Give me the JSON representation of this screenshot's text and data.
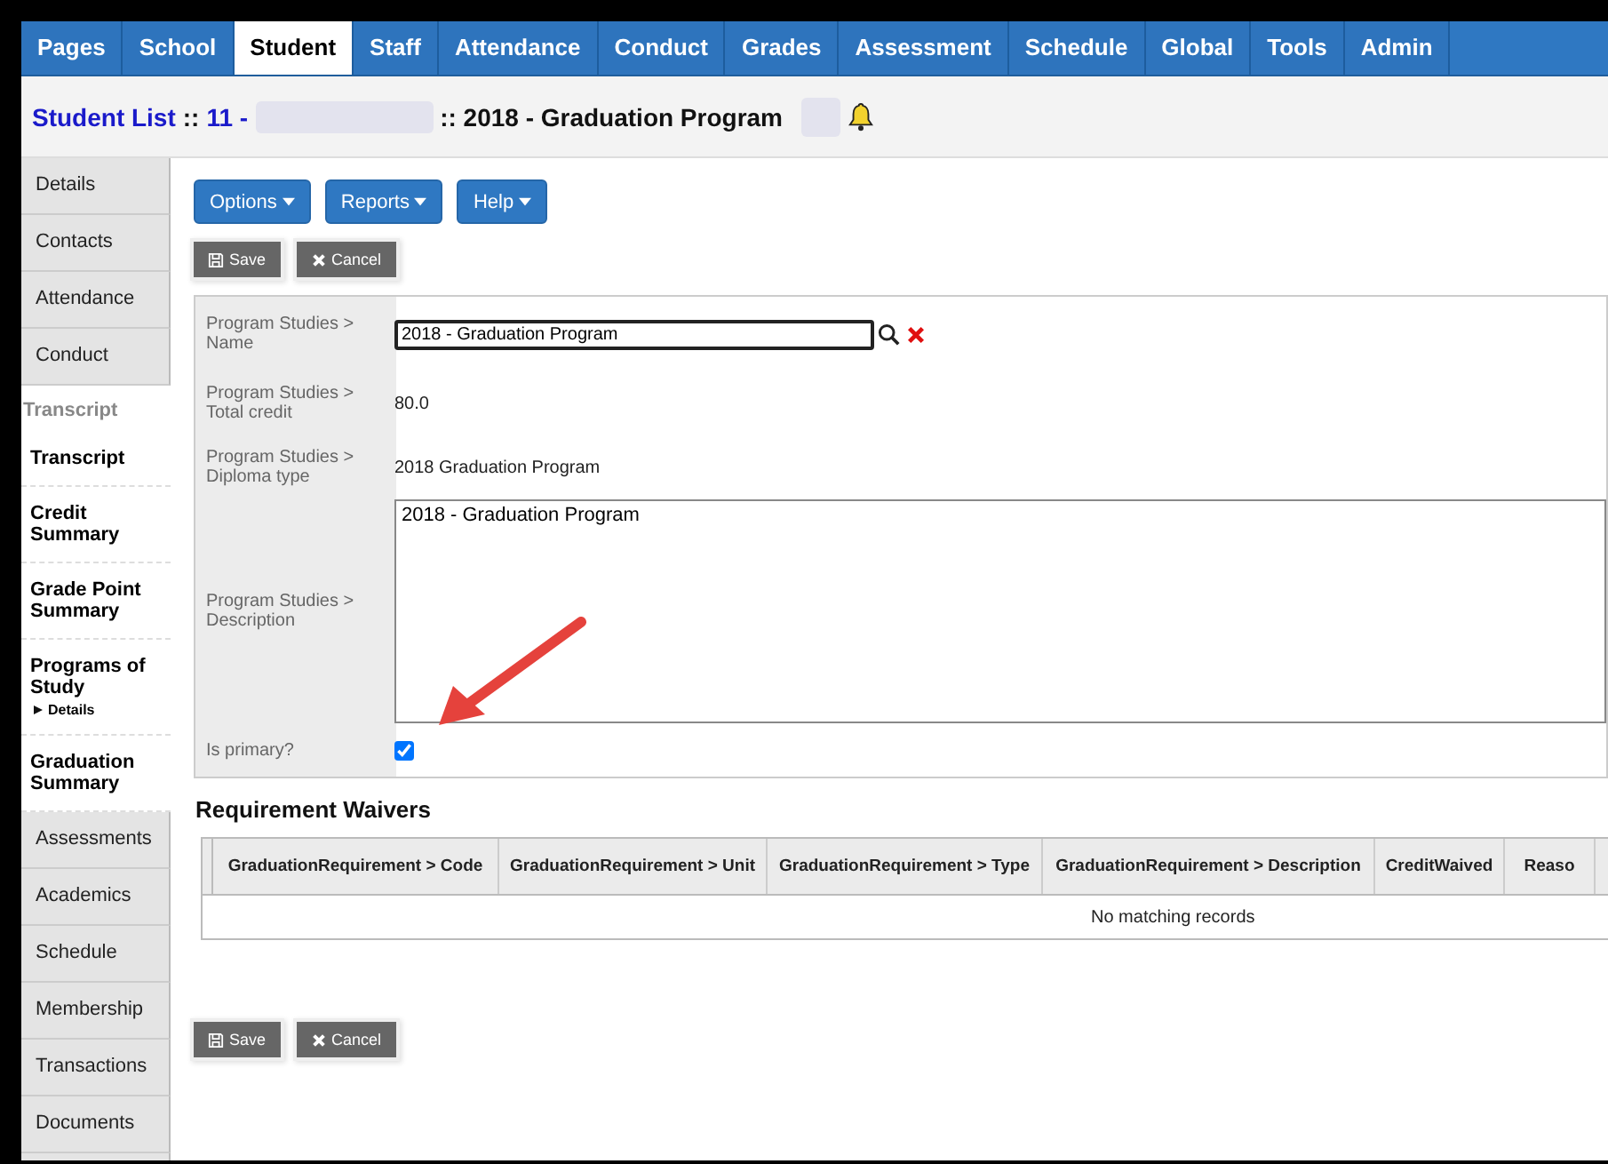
{
  "nav_tabs": [
    {
      "label": "Pages",
      "selected": false
    },
    {
      "label": "School",
      "selected": false
    },
    {
      "label": "Student",
      "selected": true
    },
    {
      "label": "Staff",
      "selected": false
    },
    {
      "label": "Attendance",
      "selected": false
    },
    {
      "label": "Conduct",
      "selected": false
    },
    {
      "label": "Grades",
      "selected": false
    },
    {
      "label": "Assessment",
      "selected": false
    },
    {
      "label": "Schedule",
      "selected": false
    },
    {
      "label": "Global",
      "selected": false
    },
    {
      "label": "Tools",
      "selected": false
    },
    {
      "label": "Admin",
      "selected": false
    }
  ],
  "breadcrumb": [
    {
      "kind": "link",
      "text": "Student List"
    },
    {
      "kind": "plain",
      "text": "::"
    },
    {
      "kind": "link",
      "text": "11 -"
    },
    {
      "kind": "redacted"
    },
    {
      "kind": "title",
      "text": ":: 2018 - Graduation Program"
    },
    {
      "kind": "redacted-small"
    }
  ],
  "sidebar": [
    {
      "kind": "tab",
      "label": "Details"
    },
    {
      "kind": "tab",
      "label": "Contacts"
    },
    {
      "kind": "tab",
      "label": "Attendance"
    },
    {
      "kind": "tab",
      "label": "Conduct"
    },
    {
      "kind": "heading",
      "label": "Transcript"
    },
    {
      "kind": "sub",
      "label": "Transcript"
    },
    {
      "kind": "sub",
      "label": "Credit Summary"
    },
    {
      "kind": "sub",
      "label": "Grade Point Summary"
    },
    {
      "kind": "sub",
      "label": "Programs of Study",
      "children": [
        {
          "label": "Details"
        }
      ]
    },
    {
      "kind": "sub",
      "label": "Graduation Summary"
    },
    {
      "kind": "tab",
      "label": "Assessments"
    },
    {
      "kind": "tab",
      "label": "Academics"
    },
    {
      "kind": "tab",
      "label": "Schedule"
    },
    {
      "kind": "tab",
      "label": "Membership"
    },
    {
      "kind": "tab",
      "label": "Transactions"
    },
    {
      "kind": "tab",
      "label": "Documents"
    }
  ],
  "menu_buttons": [
    "Options",
    "Reports",
    "Help"
  ],
  "top_actions": [
    {
      "kind": "save",
      "label": "Save"
    },
    {
      "kind": "cancel",
      "label": "Cancel"
    }
  ],
  "form": [
    {
      "kind": "lookup",
      "label": "Program Studies > Name",
      "value": "2018 - Graduation Program"
    },
    {
      "kind": "text",
      "label": "Program Studies > Total credit",
      "value": "80.0"
    },
    {
      "kind": "text",
      "label": "Program Studies > Diploma type",
      "value": "2018 Graduation Program"
    },
    {
      "kind": "textarea",
      "label": "Program Studies > Description",
      "value": "2018 - Graduation Program"
    },
    {
      "kind": "checkbox",
      "label": "Is primary?",
      "checked": true
    }
  ],
  "waivers": {
    "title": "Requirement Waivers",
    "columns": [
      "GraduationRequirement > Code",
      "GraduationRequirement > Unit",
      "GraduationRequirement > Type",
      "GraduationRequirement > Description",
      "CreditWaived",
      "Reaso"
    ],
    "empty_message": "No matching records"
  },
  "bottom_actions": [
    {
      "kind": "save",
      "label": "Save"
    },
    {
      "kind": "cancel",
      "label": "Cancel"
    }
  ]
}
